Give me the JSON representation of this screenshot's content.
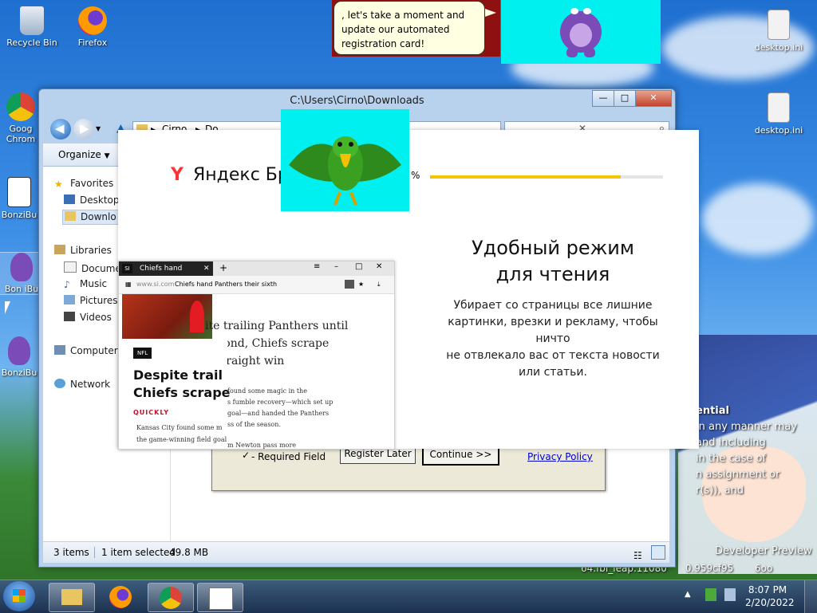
{
  "desktop": {
    "icons": {
      "recycle_bin": "Recycle Bin",
      "firefox": "Firefox",
      "chrome_line1": "Goog",
      "chrome_line2": "Chrom",
      "bonzi1": "BonziBu",
      "bonzi2": "BonziBu",
      "bonzi_selected": "Bon iBu",
      "desktop_ini_1": "desktop.ini",
      "desktop_ini_2": "desktop.ini"
    },
    "partial_text": {
      "line1": "ential",
      "line2": "in any manner may",
      "line3": "and including",
      "line4": "in the case of",
      "line5": "n assignment or",
      "line6": "r(s)), and",
      "developer": "Developer Preview",
      "build": "64.fbl_leap.11080      0.959cf95       6oo"
    },
    "accent": "#1f6fd0"
  },
  "explorer": {
    "title": "C:\\Users\\Cirno\\Downloads",
    "breadcrumb_root": "Cirno",
    "breadcrumb_next": "Do",
    "organize": "Organize",
    "nav": {
      "favorites": "Favorites",
      "desktop": "Desktop",
      "downloads": "Downlo",
      "libraries": "Libraries",
      "documents": "Docume",
      "music": "Music",
      "pictures": "Pictures",
      "videos": "Videos",
      "computer": "Computer",
      "network": "Network"
    },
    "status": {
      "items": "3 items",
      "selected": "1 item selected",
      "size": "49.8 MB"
    },
    "window_buttons": {
      "minimize": "—",
      "maximize": "□",
      "close": "✕"
    }
  },
  "registration": {
    "required_field": "- Required Field",
    "register_later": "Register Later",
    "continue": "Continue >>",
    "privacy": "Privacy Policy"
  },
  "yandex": {
    "logo": "Y",
    "brand": "Яндекс Брауз",
    "percent": "%",
    "progress_fraction": 0.82,
    "heading_line1": "Удобный режим",
    "heading_line2": "для чтения",
    "body_line1": "Убирает со страницы все лишние",
    "body_line2": "картинки, врезки и рекламу, чтобы ничто",
    "body_line3": "не отвлекало вас от текста новости",
    "body_line4": "или статьи.",
    "accent": "#f5c400"
  },
  "article": {
    "tab_badge": "SI",
    "tab_title": "Chiefs hand Panthers",
    "url_domain": "www.si.com",
    "url_title": "Chiefs hand Panthers their sixth",
    "reader_l1": "ite trailing Panthers until",
    "reader_l2": "second, Chiefs scrape",
    "reader_l3": "h straight win",
    "tag": "NFL",
    "headline_l1": "Despite trail",
    "headline_l2": "Chiefs scrape",
    "quickly": "QUICKLY",
    "bullet_l1": "Kansas City found some m",
    "bullet_l2": "the game-winning field goal",
    "body_l1": "found some magic in the",
    "body_l2": "s fumble recovery—which set up",
    "body_l3": "goal—and handed the Panthers",
    "body_l4": "ss of the season.",
    "body_l5": "m Newton pass more"
  },
  "bubble": {
    "line1": ", let's take a moment and",
    "line2": "update our automated",
    "line3": "registration card!"
  },
  "taskbar": {
    "time": "8:07 PM",
    "date": "2/20/2022"
  }
}
